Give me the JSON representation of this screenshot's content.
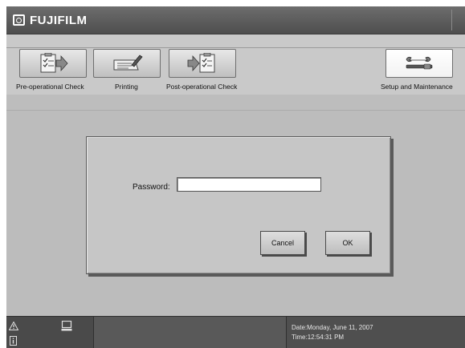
{
  "header": {
    "brand": "FUJIFILM"
  },
  "toolbar": {
    "items": [
      {
        "label": "Pre-operational Check",
        "icon": "checklist-arrow-icon"
      },
      {
        "label": "Printing",
        "icon": "printing-pen-icon"
      },
      {
        "label": "Post-operational Check",
        "icon": "arrow-checklist-icon"
      },
      {
        "label": "Setup and Maintenance",
        "icon": "tools-icon",
        "active": true
      }
    ]
  },
  "dialog": {
    "password_label": "Password:",
    "password_value": "",
    "cancel_label": "Cancel",
    "ok_label": "OK"
  },
  "status": {
    "date": "Date:Monday, June 11, 2007",
    "time": "Time:12:54:31 PM",
    "warning_icon": "warning-icon",
    "info_icon": "info-icon",
    "computer_icon": "computer-icon"
  }
}
